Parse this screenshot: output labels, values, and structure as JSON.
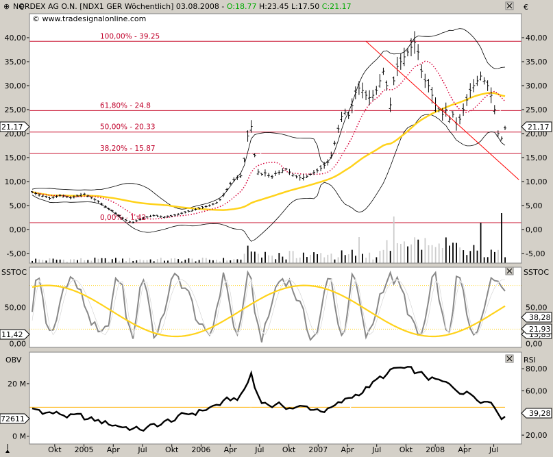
{
  "header": {
    "title": "NORDEX AG O.N. [NDX1 GER  Wöchentlich] 03.08.2008 - ",
    "open": "O:18.77",
    "hl": " H:23.45 L:17.50 ",
    "close": "C:21.17",
    "copyright": "© www.tradesignalonline.com",
    "currency_left": "€",
    "currency_right": "€"
  },
  "colors": {
    "bg": "#ffffff",
    "frame": "#d4d0c8",
    "fib": "#c8102e",
    "ma": "#ffd21a",
    "trend": "#ff0000",
    "sma_dots": "#d7003a",
    "volume": "#000000",
    "open_green": "#00aa00",
    "slow": "#888888",
    "obv": "#000000",
    "rsi": "#ffffff"
  },
  "chart_data": [
    {
      "type": "line",
      "title": "NORDEX AG O.N. [NDX1 GER  Wöchentlich]",
      "ylim": [
        -7,
        45
      ],
      "y_ticks": [
        "40,00",
        "35,00",
        "30,00",
        "25,00",
        "20,00",
        "15,00",
        "10,00",
        "5,00",
        "0,00",
        "-5,00"
      ],
      "y_tick_values": [
        40,
        35,
        30,
        25,
        20,
        15,
        10,
        5,
        0,
        -5
      ],
      "current_value_left": "21,17",
      "current_value_right": "21,17",
      "fib_levels": [
        {
          "label": "100,00% - 39.25",
          "value": 39.25
        },
        {
          "label": "61,80% - 24.8",
          "value": 24.8
        },
        {
          "label": "50,00% - 20.33",
          "value": 20.33
        },
        {
          "label": "38,20% - 15.87",
          "value": 15.87
        },
        {
          "label": "0,00% - 1.42",
          "value": 1.42
        }
      ],
      "x_ticks": [
        "Okt",
        "2005",
        "Apr",
        "Jul",
        "Okt",
        "2006",
        "Apr",
        "Jul",
        "Okt",
        "2007",
        "Apr",
        "Jul",
        "Okt",
        "2008",
        "Apr",
        "Jul"
      ],
      "x_tick_index": [
        10,
        23,
        36,
        49,
        62,
        75,
        88,
        101,
        114,
        127,
        140,
        153,
        166,
        179,
        192,
        205
      ],
      "series": [
        {
          "style": "price_bars",
          "values": [
            7.8,
            7.5,
            7.2,
            7.0,
            6.8,
            6.5,
            6.7,
            6.9,
            7.1,
            7.0,
            6.8,
            6.6,
            6.8,
            7.0,
            7.2,
            7.4,
            7.0,
            6.6,
            6.2,
            5.8,
            5.3,
            4.8,
            4.3,
            3.9,
            3.4,
            2.9,
            2.4,
            1.9,
            1.6,
            1.5,
            1.8,
            2.1,
            2.4,
            2.6,
            2.8,
            2.9,
            2.8,
            2.7,
            2.6,
            2.7,
            2.8,
            3.0,
            3.2,
            3.4,
            3.6,
            3.8,
            4.0,
            4.2,
            4.4,
            4.6,
            4.8,
            5.0,
            5.3,
            5.6,
            6.2,
            7.2,
            8.4,
            9.6,
            10.4,
            10.8,
            11.2,
            14.5,
            19.5,
            21.5,
            15.5,
            12.0,
            11.5,
            11.8,
            11.3,
            11.0,
            11.7,
            11.9,
            12.3,
            12.6,
            12.0,
            11.4,
            11.0,
            10.8,
            10.9,
            11.1,
            11.5,
            11.9,
            12.3,
            12.8,
            13.4,
            14.0,
            15.5,
            18.0,
            21.0,
            23.5,
            24.5,
            23.8,
            25.8,
            28.5,
            29.5,
            29.0,
            28.0,
            27.5,
            28.0,
            29.0,
            31.0,
            33.0,
            30.0,
            26.0,
            31.0,
            34.0,
            35.0,
            36.0,
            37.0,
            38.0,
            39.0,
            37.0,
            33.0,
            31.0,
            30.0,
            28.0,
            26.0,
            25.0,
            24.0,
            25.0,
            23.0,
            24.0,
            22.0,
            23.0,
            25.0,
            27.0,
            29.0,
            30.0,
            31.0,
            32.0,
            31.0,
            30.0,
            28.0,
            25.0,
            20.0,
            19.0,
            21.17
          ]
        },
        {
          "style": "bollinger_upper"
        },
        {
          "style": "bollinger_lower"
        },
        {
          "style": "ma_yellow"
        },
        {
          "style": "sma_dotted"
        },
        {
          "style": "white_line"
        },
        {
          "style": "trendline",
          "from": [
            96,
            39.25
          ],
          "to": [
            136,
            13.0
          ]
        },
        {
          "style": "volume"
        }
      ]
    },
    {
      "type": "line",
      "title": "SSTOC",
      "label_left": "SSTOC",
      "label_right": "SSTOC",
      "ylim": [
        -5,
        105
      ],
      "y_ticks": [
        "50,00",
        "0,00"
      ],
      "y_tick_values": [
        50,
        0
      ],
      "reference_levels": [
        80,
        20
      ],
      "current_value_left": "11,42",
      "right_values": [
        "38,28",
        "21,93",
        "13,83"
      ],
      "series": [
        {
          "style": "fast_gray"
        },
        {
          "style": "slow_white"
        },
        {
          "style": "signal_yellow"
        }
      ]
    },
    {
      "type": "line",
      "title": "OBV / RSI",
      "label_left": "OBV",
      "label_right": "RSI",
      "left_ticks": [
        "20 M",
        "0 M"
      ],
      "left_tick_values": [
        20,
        0
      ],
      "left_ylim": [
        -3,
        32
      ],
      "right_ticks": [
        "80,00",
        "60,00",
        "40,00",
        "20,00"
      ],
      "right_tick_values": [
        80,
        60,
        40,
        20
      ],
      "right_ylim": [
        12,
        95
      ],
      "current_value_left": "72611",
      "current_value_right": "39,28",
      "series": [
        {
          "style": "obv_black"
        },
        {
          "style": "rsi_white"
        },
        {
          "style": "obv_ma_orange"
        }
      ]
    }
  ]
}
